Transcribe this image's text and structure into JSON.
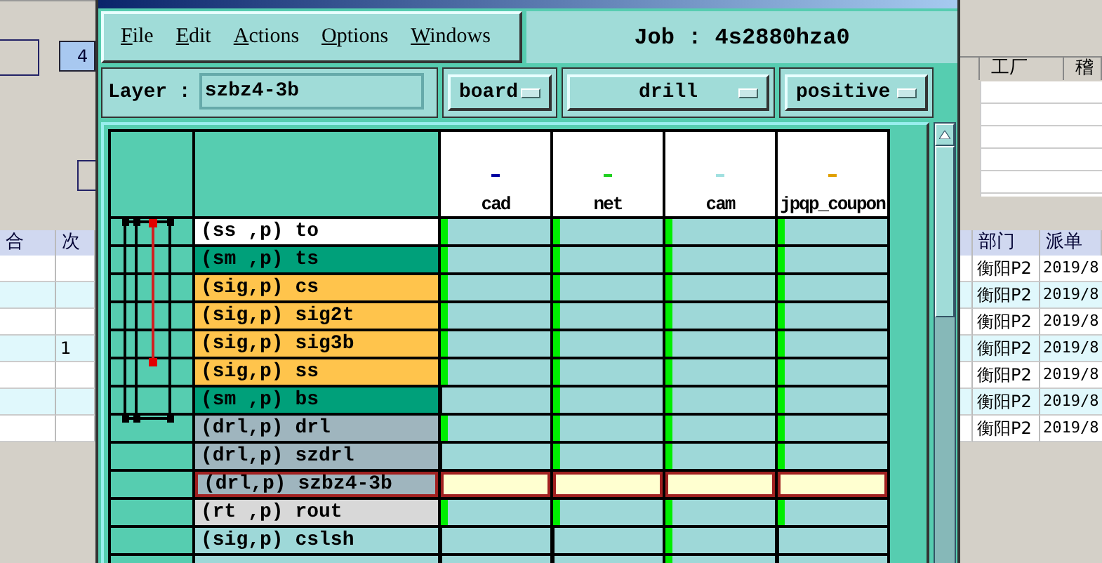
{
  "background_app": {
    "field_value": "4",
    "upper_table": {
      "columns": [
        "工厂",
        "稽"
      ]
    },
    "lower_table": {
      "columns": [
        "合",
        "次",
        "部门",
        "派单"
      ],
      "rows": [
        {
          "dept": "衡阳P2",
          "date": "2019/8"
        },
        {
          "dept": "衡阳P2",
          "date": "2019/8"
        },
        {
          "dept": "衡阳P2",
          "date": "2019/8"
        },
        {
          "count": "1",
          "dept": "衡阳P2",
          "date": "2019/8"
        },
        {
          "dept": "衡阳P2",
          "date": "2019/8"
        },
        {
          "dept": "衡阳P2",
          "date": "2019/8"
        },
        {
          "dept": "衡阳P2",
          "date": "2019/8"
        }
      ]
    }
  },
  "popup": {
    "menu": [
      "File",
      "Edit",
      "Actions",
      "Options",
      "Windows"
    ],
    "job_title": "Job : 4s2880hza0",
    "layer_label": "Layer :",
    "layer_value": "szbz4-3b",
    "option_menus": [
      "board",
      "drill",
      "positive"
    ],
    "matrix": {
      "columns": [
        {
          "name": "cad",
          "color": "#0000a0"
        },
        {
          "name": "net",
          "color": "#20d020"
        },
        {
          "name": "cam",
          "color": "#a0e0e0"
        },
        {
          "name": "jpqp_coupon",
          "color": "#e0a000"
        }
      ],
      "rows": [
        {
          "name": "(ss ,p) to",
          "color": "#ffffff",
          "selected": false,
          "cells": [
            true,
            true,
            true,
            true
          ]
        },
        {
          "name": "(sm ,p) ts",
          "color": "#00a07a",
          "selected": false,
          "cells": [
            true,
            true,
            true,
            true
          ]
        },
        {
          "name": "(sig,p) cs",
          "color": "#ffc44c",
          "selected": false,
          "cells": [
            true,
            true,
            true,
            true
          ]
        },
        {
          "name": "(sig,p) sig2t",
          "color": "#ffc44c",
          "selected": false,
          "cells": [
            true,
            true,
            true,
            true
          ]
        },
        {
          "name": "(sig,p) sig3b",
          "color": "#ffc44c",
          "selected": false,
          "cells": [
            true,
            true,
            true,
            true
          ]
        },
        {
          "name": "(sig,p) ss",
          "color": "#ffc44c",
          "selected": false,
          "cells": [
            true,
            true,
            true,
            true
          ]
        },
        {
          "name": "(sm ,p) bs",
          "color": "#00a07a",
          "selected": false,
          "cells": [
            false,
            true,
            true,
            true
          ]
        },
        {
          "name": "(drl,p) drl",
          "color": "#9fb5be",
          "selected": false,
          "cells": [
            true,
            true,
            true,
            true
          ]
        },
        {
          "name": "(drl,p) szdrl",
          "color": "#9fb5be",
          "selected": false,
          "cells": [
            false,
            true,
            true,
            true
          ]
        },
        {
          "name": "(drl,p) szbz4-3b",
          "color": "#9fb5be",
          "selected": true,
          "cells": [
            false,
            false,
            false,
            false
          ]
        },
        {
          "name": "(rt ,p) rout",
          "color": "#d8d8d8",
          "selected": false,
          "cells": [
            true,
            true,
            true,
            true
          ]
        },
        {
          "name": "(sig,p) cslsh",
          "color": "#9ed8d8",
          "selected": false,
          "cells": [
            false,
            false,
            true,
            false
          ]
        }
      ]
    }
  }
}
